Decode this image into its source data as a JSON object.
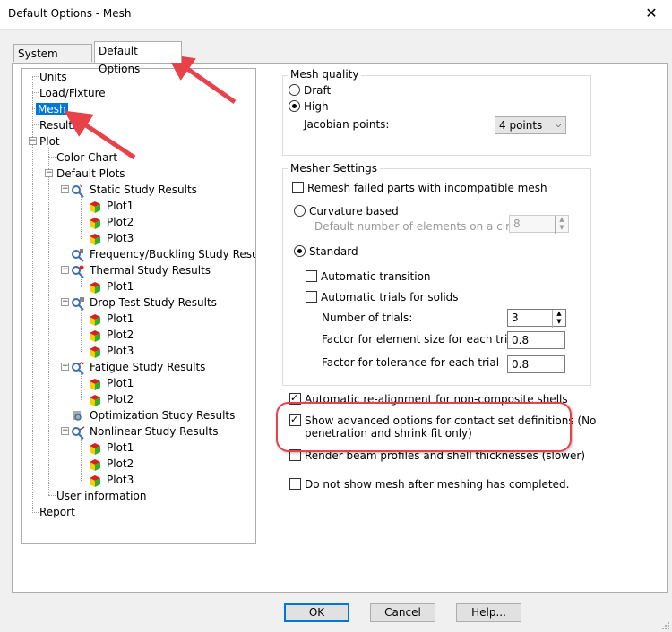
{
  "window": {
    "title": "Default Options - Mesh",
    "close_glyph": "✕"
  },
  "tabs": [
    {
      "label": "System Options",
      "active": false
    },
    {
      "label": "Default Options",
      "active": true
    }
  ],
  "tree": {
    "units": "Units",
    "load_fixture": "Load/Fixture",
    "mesh": "Mesh",
    "results": "Results",
    "plot": "Plot",
    "color_chart": "Color Chart",
    "default_plots": "Default Plots",
    "static": "Static Study Results",
    "frequency": "Frequency/Buckling Study Results",
    "thermal": "Thermal Study Results",
    "drop": "Drop Test Study Results",
    "fatigue": "Fatigue Study Results",
    "optimization": "Optimization Study Results",
    "nonlinear": "Nonlinear Study Results",
    "plot1": "Plot1",
    "plot2": "Plot2",
    "plot3": "Plot3",
    "user_information": "User information",
    "report": "Report"
  },
  "mesh_quality": {
    "legend": "Mesh quality",
    "draft": "Draft",
    "high": "High",
    "selected": "High",
    "jacobian_label": "Jacobian points:",
    "jacobian_value": "4 points"
  },
  "mesher_settings": {
    "legend": "Mesher Settings",
    "remesh_failed": "Remesh failed parts with incompatible mesh",
    "remesh_failed_checked": false,
    "curvature_based": "Curvature based",
    "default_elements_label": "Default number of elements on a circle:",
    "default_elements_value": "8",
    "standard": "Standard",
    "selected": "Standard",
    "automatic_transition": "Automatic transition",
    "automatic_trials": "Automatic trials for solids",
    "number_of_trials_label": "Number of trials:",
    "number_of_trials_value": "3",
    "factor_element_label": "Factor for element size for each trial",
    "factor_element_value": "0.8",
    "factor_tolerance_label": "Factor for tolerance for each trial",
    "factor_tolerance_value": "0.8"
  },
  "options": {
    "auto_realignment": "Automatic re-alignment for non-composite shells",
    "auto_realignment_checked": true,
    "advanced_contact_line1": "Show advanced options for contact set definitions (No",
    "advanced_contact_line2": "penetration and shrink fit only)",
    "advanced_contact_checked": true,
    "render_beam": "Render beam profiles and shell thicknesses (slower)",
    "render_beam_checked": false,
    "no_show_mesh": "Do not show mesh after meshing has completed.",
    "no_show_mesh_checked": false
  },
  "buttons": {
    "ok": "OK",
    "cancel": "Cancel",
    "help": "Help..."
  },
  "colors": {
    "accent": "#0078d7",
    "annotation": "#e8414a",
    "plot_icon_red": "#d82020",
    "plot_icon_green": "#2db02d",
    "plot_icon_yellow": "#f5d000"
  }
}
